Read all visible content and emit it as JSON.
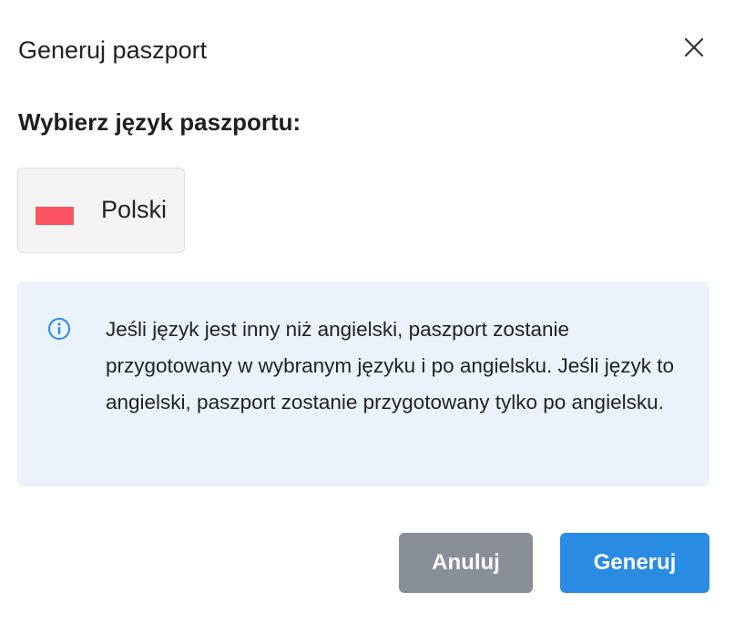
{
  "dialog": {
    "title": "Generuj paszport",
    "close_icon": "close-icon",
    "heading": "Wybierz język paszportu:",
    "language_option": {
      "label": "Polski",
      "flag_icon": "poland-flag-icon"
    },
    "info": {
      "icon": "info-circle-icon",
      "text": "Jeśli język jest inny niż angielski, paszport zostanie przygotowany w wybranym języku i po angielsku. Jeśli język to angielski, paszport zostanie przygotowany tylko po angielsku."
    },
    "buttons": {
      "cancel_label": "Anuluj",
      "generate_label": "Generuj"
    }
  },
  "colors": {
    "info_background": "#eaf3fb",
    "info_icon": "#2a8be3",
    "primary": "#2a8be3",
    "secondary": "#888f96",
    "flag_red": "#fc5360"
  }
}
